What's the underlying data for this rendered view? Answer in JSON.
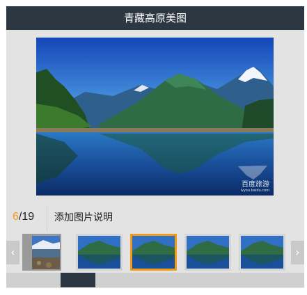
{
  "header": {
    "title": "青藏高原美图"
  },
  "photo": {
    "watermark": "百度旅游",
    "watermark_sub": "lvyou.baidu.com"
  },
  "caption": {
    "current": "6",
    "separator": "/",
    "total": "19",
    "text": "添加图片说明"
  },
  "thumbnails": [
    {
      "name": "thumb-1",
      "selected": false
    },
    {
      "name": "thumb-2",
      "selected": false
    },
    {
      "name": "thumb-3",
      "selected": true
    },
    {
      "name": "thumb-4",
      "selected": false
    },
    {
      "name": "thumb-5",
      "selected": false
    }
  ],
  "icons": {
    "prev": "chevron-left-icon",
    "next": "chevron-right-icon"
  },
  "colors": {
    "header_bg": "#2c3742",
    "accent": "#f29b16",
    "panel_bg": "#e3e3e3"
  }
}
